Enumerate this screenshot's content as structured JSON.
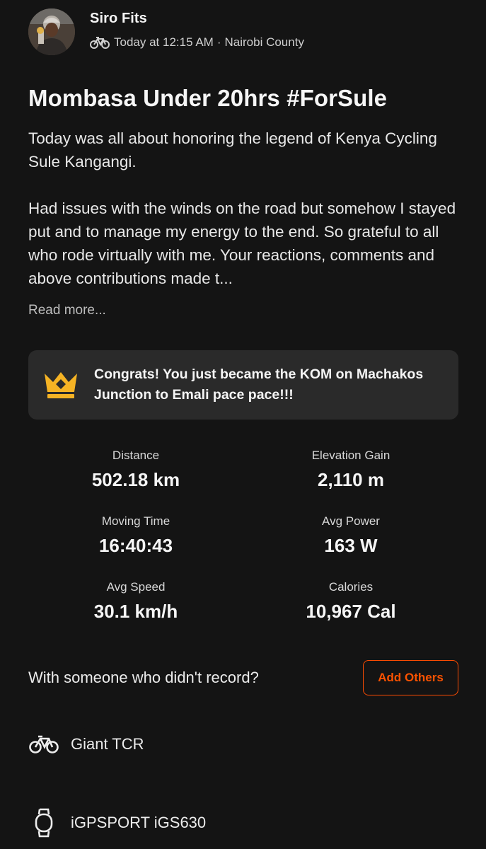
{
  "activity": {
    "athlete_name": "Siro Fits",
    "timestamp": "Today at 12:15 AM",
    "separator": "·",
    "location": "Nairobi County",
    "title": "Mombasa Under 20hrs #ForSule",
    "description_p1": "Today was all about honoring the legend of Kenya Cycling Sule Kangangi.",
    "description_p2": "Had issues with the winds on the road but somehow I stayed put and to manage my energy to the end. So grateful to all who rode virtually with me. Your reactions, comments and above contributions made t...",
    "read_more": "Read more..."
  },
  "kom": {
    "message": "Congrats! You just became the KOM on Machakos Junction to Emali pace pace!!!",
    "icon": "crown-icon",
    "icon_color": "#f5b324"
  },
  "stats": [
    {
      "label": "Distance",
      "value": "502.18 km"
    },
    {
      "label": "Elevation Gain",
      "value": "2,110 m"
    },
    {
      "label": "Moving Time",
      "value": "16:40:43"
    },
    {
      "label": "Avg Power",
      "value": "163 W"
    },
    {
      "label": "Avg Speed",
      "value": "30.1 km/h"
    },
    {
      "label": "Calories",
      "value": "10,967 Cal"
    }
  ],
  "others": {
    "prompt": "With someone who didn't record?",
    "button_label": "Add Others",
    "accent": "#fc4c02"
  },
  "gear": [
    {
      "icon": "bike-icon",
      "label": "Giant TCR"
    },
    {
      "icon": "watch-icon",
      "label": "iGPSPORT iGS630"
    }
  ]
}
